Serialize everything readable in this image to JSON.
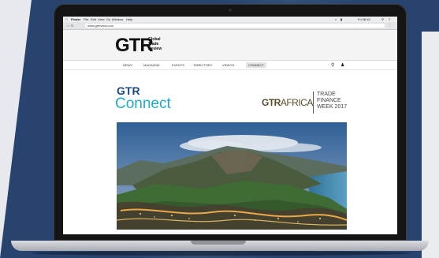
{
  "menubar": {
    "items": [
      "Finder",
      "File",
      "Edit",
      "View",
      "Go",
      "Window",
      "Help"
    ],
    "clock": "Fri 08:44"
  },
  "browser": {
    "url": "www.gtreview.com",
    "back_icon": "chevron-left-icon",
    "forward_icon": "chevron-right-icon",
    "reload_icon": "reload-icon"
  },
  "site": {
    "logo": "GTR",
    "logo_sub": [
      "Global",
      "Trade",
      "Review"
    ],
    "nav": [
      "NEWS",
      "MAGAZINE",
      "EVENTS",
      "DIRECTORY",
      "VIDEOS",
      "CONNECT"
    ],
    "active_nav": "CONNECT",
    "search_icon": "search-icon",
    "user_icon": "user-icon"
  },
  "hero": {
    "connect_brand": "GTR",
    "connect_word": "Connect",
    "event_brand_bold": "GTR",
    "event_brand_rest": "AFRICA",
    "event_title_lines": [
      "TRADE",
      "FINANCE",
      "WEEK 2017"
    ]
  },
  "colors": {
    "background": "#27436e",
    "connect_accent": "#1fa9c9",
    "connect_dark": "#1b4a7a",
    "africa_brand": "#5a4d2e"
  }
}
